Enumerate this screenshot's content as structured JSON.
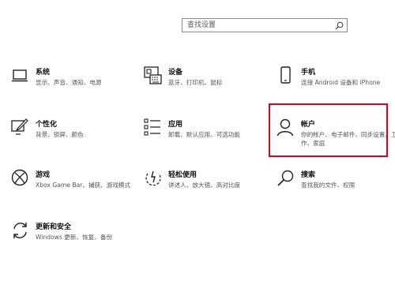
{
  "search": {
    "placeholder": "查找设置"
  },
  "tiles": [
    {
      "name": "系统",
      "desc": "显示、声音、通知、电源",
      "icon": "laptop-icon"
    },
    {
      "name": "设备",
      "desc": "蓝牙、打印机、鼠标",
      "icon": "keyboard-icon"
    },
    {
      "name": "手机",
      "desc": "连接 Android 设备和 iPhone",
      "icon": "phone-icon"
    },
    {
      "name": "个性化",
      "desc": "背景、锁屏、颜色",
      "icon": "personalize-icon"
    },
    {
      "name": "应用",
      "desc": "卸载、默认应用、可选功能",
      "icon": "apps-icon"
    },
    {
      "name": "帐户",
      "desc": "你的帐户、电子邮件、同步设置、工作、家庭",
      "icon": "person-icon"
    },
    {
      "name": "游戏",
      "desc": "Xbox Game Bar、捕获、游戏模式",
      "icon": "xbox-icon"
    },
    {
      "name": "轻松使用",
      "desc": "讲述人、放大镜、高对比度",
      "icon": "ease-of-access-icon"
    },
    {
      "name": "搜索",
      "desc": "查找我的文件、权限",
      "icon": "search-icon"
    },
    {
      "name": "更新和安全",
      "desc": "Windows 更新、恢复、备份",
      "icon": "update-icon"
    }
  ],
  "highlight_color": "#e0001b"
}
